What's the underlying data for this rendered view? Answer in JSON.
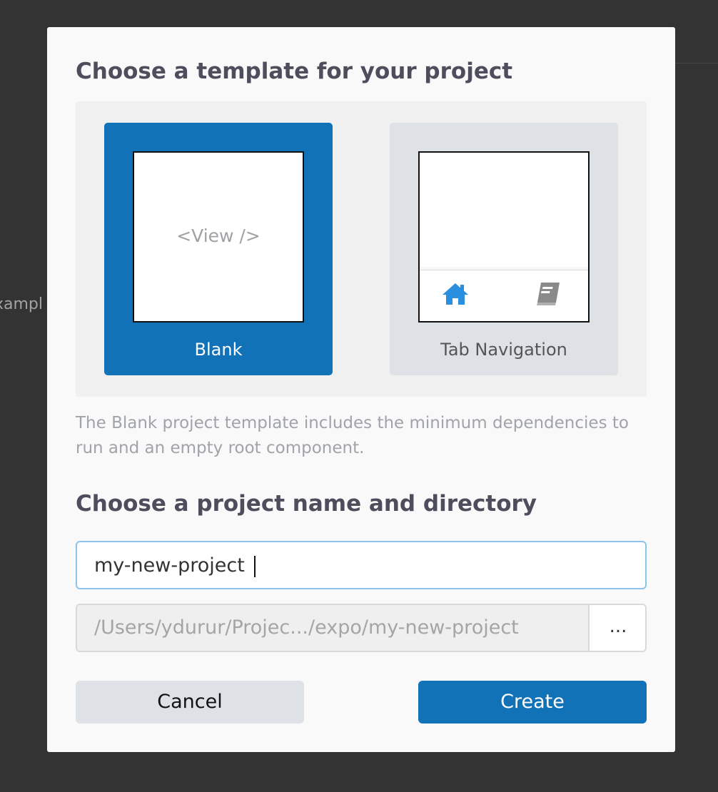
{
  "background": {
    "partial_text": "xampl"
  },
  "dialog": {
    "template_heading": "Choose a template for your project",
    "templates": [
      {
        "label": "Blank",
        "preview_text": "<View />",
        "selected": true
      },
      {
        "label": "Tab Navigation",
        "selected": false,
        "tab_icons": [
          "home-icon",
          "book-icon"
        ]
      }
    ],
    "description": "The Blank project template includes the minimum dependencies to run and an empty root component.",
    "name_heading": "Choose a project name and directory",
    "project_name": "my-new-project",
    "directory": "/Users/ydurur/Projec.../expo/my-new-project",
    "browse_label": "...",
    "cancel_label": "Cancel",
    "create_label": "Create"
  },
  "colors": {
    "accent": "#1172b8",
    "tab_icon_active": "#2b8fe0",
    "tab_icon_inactive": "#8a8a8a"
  }
}
